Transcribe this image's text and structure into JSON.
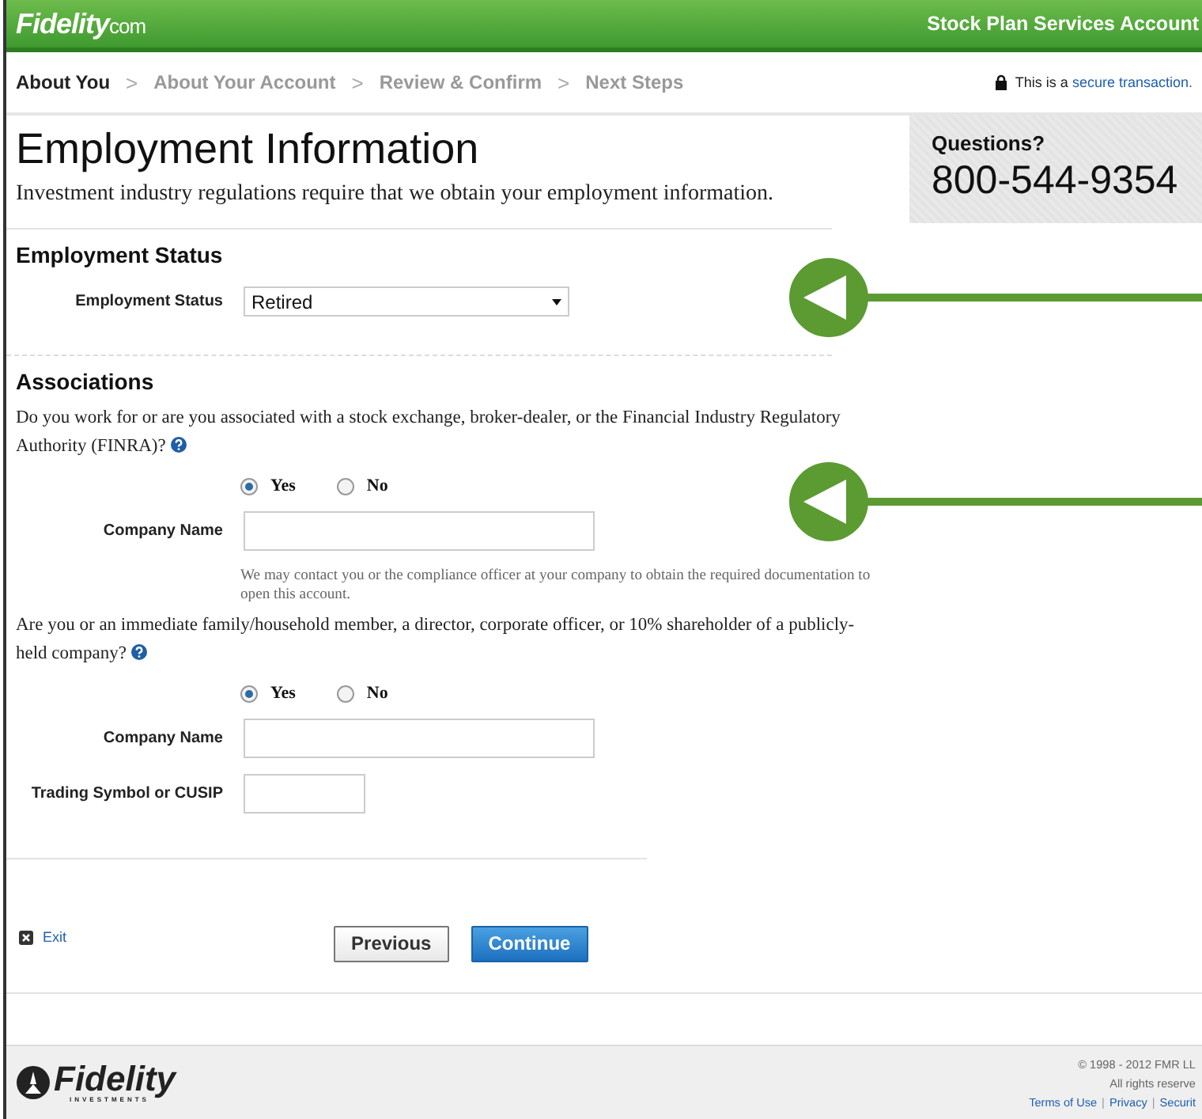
{
  "header": {
    "logo": "Fidelity",
    "logo_suffix": "com",
    "account": "Stock Plan Services Account"
  },
  "steps": [
    {
      "label": "About You",
      "selected": true
    },
    {
      "label": "About Your Account",
      "selected": false
    },
    {
      "label": "Review & Confirm",
      "selected": false
    },
    {
      "label": "Next Steps",
      "selected": false
    }
  ],
  "step_separator": ">",
  "secure": {
    "text": "This is a",
    "link": "secure transaction."
  },
  "page": {
    "title": "Employment Information",
    "intro": "Investment industry regulations require that we obtain your employment information."
  },
  "questions_panel": {
    "label": "Questions?",
    "phone": "800-544-9354"
  },
  "employment": {
    "heading": "Employment Status",
    "label": "Employment Status",
    "value": "Retired"
  },
  "associations": {
    "heading": "Associations",
    "questions": [
      {
        "text": "Do you work for or are you associated with a stock exchange, broker-dealer, or the Financial Industry Regulatory Authority (FINRA)?",
        "options": [
          {
            "label": "Yes",
            "selected": true
          },
          {
            "label": "No",
            "selected": false
          }
        ],
        "fields": [
          {
            "label": "Company Name",
            "kind": "name"
          }
        ],
        "note": "We may contact you or the compliance officer at your company to obtain the required documentation to open this account."
      },
      {
        "text": "Are you or an immediate family/household member, a director, corporate officer, or 10% shareholder of a publicly-held company?",
        "options": [
          {
            "label": "Yes",
            "selected": true
          },
          {
            "label": "No",
            "selected": false
          }
        ],
        "fields": [
          {
            "label": "Company Name",
            "kind": "name"
          },
          {
            "label": "Trading Symbol or CUSIP",
            "kind": "symbol"
          }
        ]
      }
    ]
  },
  "actions": {
    "exit": "Exit",
    "buttons": [
      {
        "label": "Previous",
        "kind": "secondary"
      },
      {
        "label": "Continue",
        "kind": "primary"
      }
    ]
  },
  "footer": {
    "logo": "Fidelity",
    "logo_sub": "INVESTMENTS",
    "lines": [
      "© 1998 - 2012 FMR LL",
      "All rights reserve"
    ],
    "links": [
      "Terms of Use",
      "Privacy",
      "Securit"
    ],
    "link_separator": "|"
  }
}
